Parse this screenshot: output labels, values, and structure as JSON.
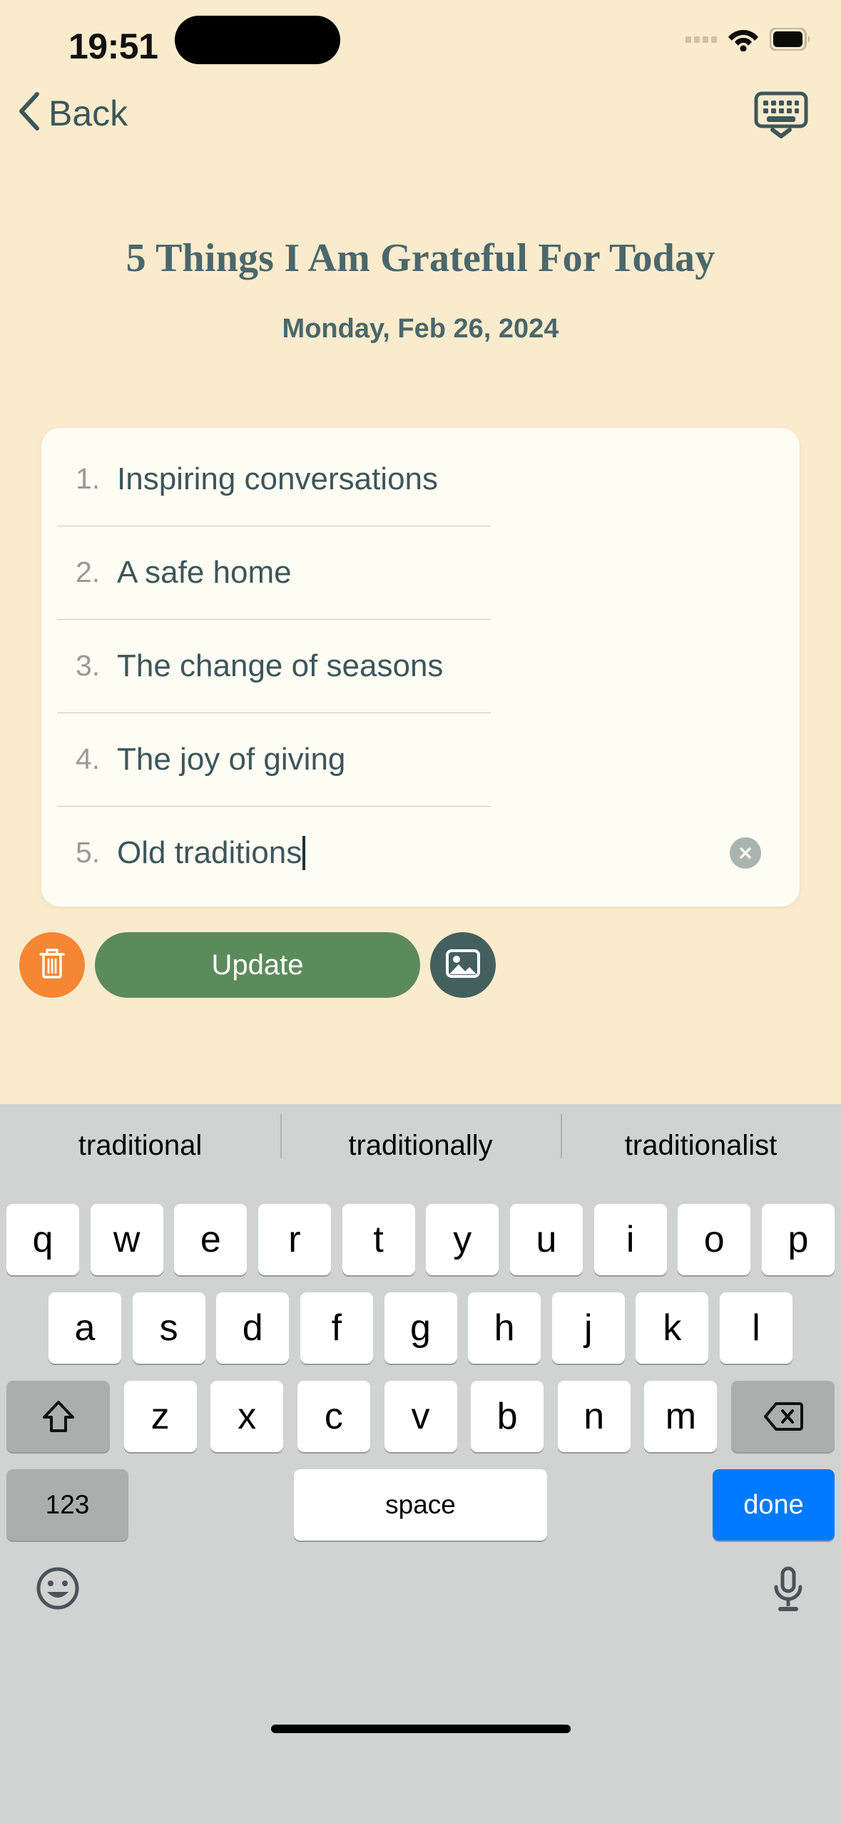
{
  "status_bar": {
    "time": "19:51",
    "cellular_icon": "cellular-dots-icon",
    "wifi_icon": "wifi-icon",
    "battery_icon": "battery-icon"
  },
  "nav_bar": {
    "back_label": "Back",
    "back_icon": "chevron-left-icon",
    "keyboard_dismiss_icon": "keyboard-dismiss-icon"
  },
  "header": {
    "title": "5 Things I Am Grateful For Today",
    "date": "Monday, Feb 26, 2024"
  },
  "list": {
    "items": [
      {
        "number": "1.",
        "text": "Inspiring conversations"
      },
      {
        "number": "2.",
        "text": "A safe home"
      },
      {
        "number": "3.",
        "text": "The change of seasons"
      },
      {
        "number": "4.",
        "text": "The joy of giving"
      },
      {
        "number": "5.",
        "text": "Old traditions"
      }
    ],
    "active_index": 4,
    "clear_icon": "clear-circle-x-icon"
  },
  "actions": {
    "delete_icon": "trash-icon",
    "update_label": "Update",
    "image_icon": "photo-image-icon"
  },
  "keyboard": {
    "suggestions": [
      "traditional",
      "traditionally",
      "traditionalist"
    ],
    "row1": [
      "q",
      "w",
      "e",
      "r",
      "t",
      "y",
      "u",
      "i",
      "o",
      "p"
    ],
    "row2": [
      "a",
      "s",
      "d",
      "f",
      "g",
      "h",
      "j",
      "k",
      "l"
    ],
    "row3_letters": [
      "z",
      "x",
      "c",
      "v",
      "b",
      "n",
      "m"
    ],
    "shift_icon": "shift-up-arrow-icon",
    "backspace_icon": "backspace-delete-icon",
    "numbers_label": "123",
    "space_label": "space",
    "done_label": "done",
    "emoji_icon": "emoji-smiley-icon",
    "mic_icon": "microphone-icon"
  },
  "colors": {
    "page_background": "#FAEBCD",
    "card_background": "#FDFDF4",
    "accent_text": "#3D565A",
    "title_text": "#4A676B",
    "update_green": "#5C8B5B",
    "delete_orange": "#F58634",
    "image_slate": "#44605E",
    "done_blue": "#007AFF",
    "keyboard_background": "#D1D2D2"
  }
}
